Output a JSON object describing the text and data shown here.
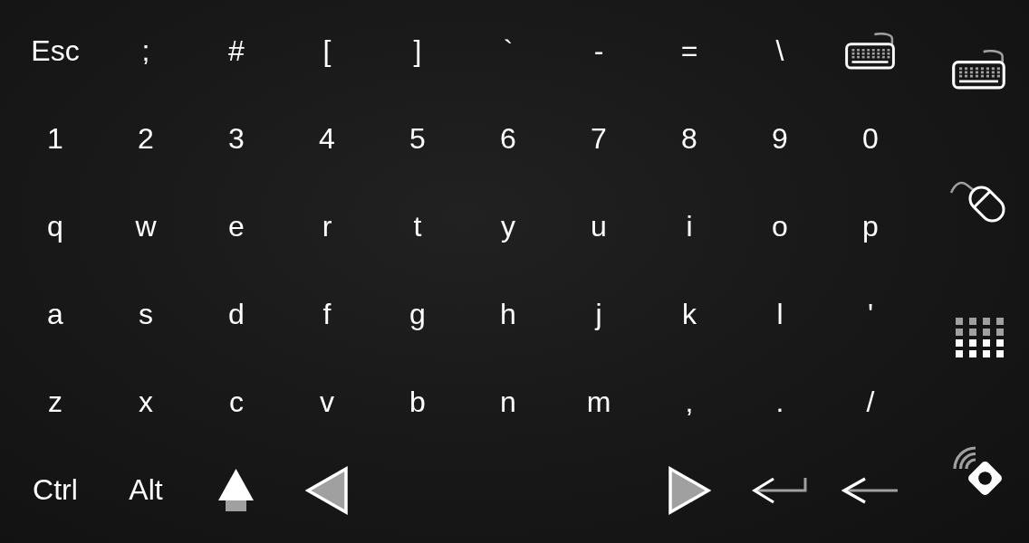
{
  "keyboard": {
    "rows": [
      [
        {
          "kind": "char",
          "label": "Esc"
        },
        {
          "kind": "char",
          "label": ";"
        },
        {
          "kind": "char",
          "label": "#"
        },
        {
          "kind": "char",
          "label": "["
        },
        {
          "kind": "char",
          "label": "]"
        },
        {
          "kind": "char",
          "label": "`"
        },
        {
          "kind": "char",
          "label": "-"
        },
        {
          "kind": "char",
          "label": "="
        },
        {
          "kind": "char",
          "label": "\\"
        },
        {
          "kind": "keyboard"
        }
      ],
      [
        {
          "kind": "char",
          "label": "1"
        },
        {
          "kind": "char",
          "label": "2"
        },
        {
          "kind": "char",
          "label": "3"
        },
        {
          "kind": "char",
          "label": "4"
        },
        {
          "kind": "char",
          "label": "5"
        },
        {
          "kind": "char",
          "label": "6"
        },
        {
          "kind": "char",
          "label": "7"
        },
        {
          "kind": "char",
          "label": "8"
        },
        {
          "kind": "char",
          "label": "9"
        },
        {
          "kind": "char",
          "label": "0"
        }
      ],
      [
        {
          "kind": "char",
          "label": "q"
        },
        {
          "kind": "char",
          "label": "w"
        },
        {
          "kind": "char",
          "label": "e"
        },
        {
          "kind": "char",
          "label": "r"
        },
        {
          "kind": "char",
          "label": "t"
        },
        {
          "kind": "char",
          "label": "y"
        },
        {
          "kind": "char",
          "label": "u"
        },
        {
          "kind": "char",
          "label": "i"
        },
        {
          "kind": "char",
          "label": "o"
        },
        {
          "kind": "char",
          "label": "p"
        }
      ],
      [
        {
          "kind": "char",
          "label": "a"
        },
        {
          "kind": "char",
          "label": "s"
        },
        {
          "kind": "char",
          "label": "d"
        },
        {
          "kind": "char",
          "label": "f"
        },
        {
          "kind": "char",
          "label": "g"
        },
        {
          "kind": "char",
          "label": "h"
        },
        {
          "kind": "char",
          "label": "j"
        },
        {
          "kind": "char",
          "label": "k"
        },
        {
          "kind": "char",
          "label": "l"
        },
        {
          "kind": "char",
          "label": "'"
        }
      ],
      [
        {
          "kind": "char",
          "label": "z"
        },
        {
          "kind": "char",
          "label": "x"
        },
        {
          "kind": "char",
          "label": "c"
        },
        {
          "kind": "char",
          "label": "v"
        },
        {
          "kind": "char",
          "label": "b"
        },
        {
          "kind": "char",
          "label": "n"
        },
        {
          "kind": "char",
          "label": "m"
        },
        {
          "kind": "char",
          "label": ","
        },
        {
          "kind": "char",
          "label": "."
        },
        {
          "kind": "char",
          "label": "/"
        }
      ]
    ],
    "bottom_row": {
      "left": [
        {
          "kind": "char",
          "label": "Ctrl"
        },
        {
          "kind": "char",
          "label": "Alt"
        },
        {
          "kind": "shift"
        },
        {
          "kind": "left"
        }
      ],
      "right": [
        {
          "kind": "right"
        },
        {
          "kind": "enter"
        },
        {
          "kind": "backspace"
        }
      ]
    }
  },
  "sidebar": {
    "modes": [
      {
        "kind": "keyboard"
      },
      {
        "kind": "mouse"
      },
      {
        "kind": "keypad"
      },
      {
        "kind": "remote"
      }
    ]
  }
}
